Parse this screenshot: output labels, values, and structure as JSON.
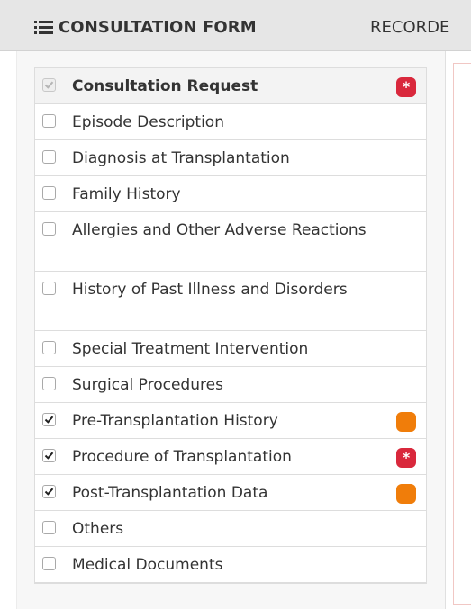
{
  "header": {
    "active_tab": "CONSULTATION FORM",
    "next_tab": "RECORDE",
    "active_tab_icon": "list-icon"
  },
  "colors": {
    "required_badge": "#d9283c",
    "partial_badge": "#f07d0a",
    "header_bar": "#e6e6e6"
  },
  "sections": [
    {
      "label": "Consultation Request",
      "checked": true,
      "disabled": true,
      "badge": "required",
      "badge_text": "*"
    },
    {
      "label": "Episode Description",
      "checked": false,
      "badge": null
    },
    {
      "label": "Diagnosis at Transplantation",
      "checked": false,
      "badge": null
    },
    {
      "label": "Family History",
      "checked": false,
      "badge": null
    },
    {
      "label": "Allergies and Other Adverse Reactions",
      "checked": false,
      "badge": null
    },
    {
      "label": "History of Past Illness and Disorders",
      "checked": false,
      "badge": null
    },
    {
      "label": "Special Treatment Intervention",
      "checked": false,
      "badge": null
    },
    {
      "label": "Surgical Procedures",
      "checked": false,
      "badge": null
    },
    {
      "label": "Pre-Transplantation History",
      "checked": true,
      "badge": "partial",
      "badge_text": ""
    },
    {
      "label": "Procedure of Transplantation",
      "checked": true,
      "badge": "required",
      "badge_text": "*"
    },
    {
      "label": "Post-Transplantation Data",
      "checked": true,
      "badge": "partial",
      "badge_text": ""
    },
    {
      "label": "Others",
      "checked": false,
      "badge": null
    },
    {
      "label": "Medical Documents",
      "checked": false,
      "badge": null
    }
  ]
}
